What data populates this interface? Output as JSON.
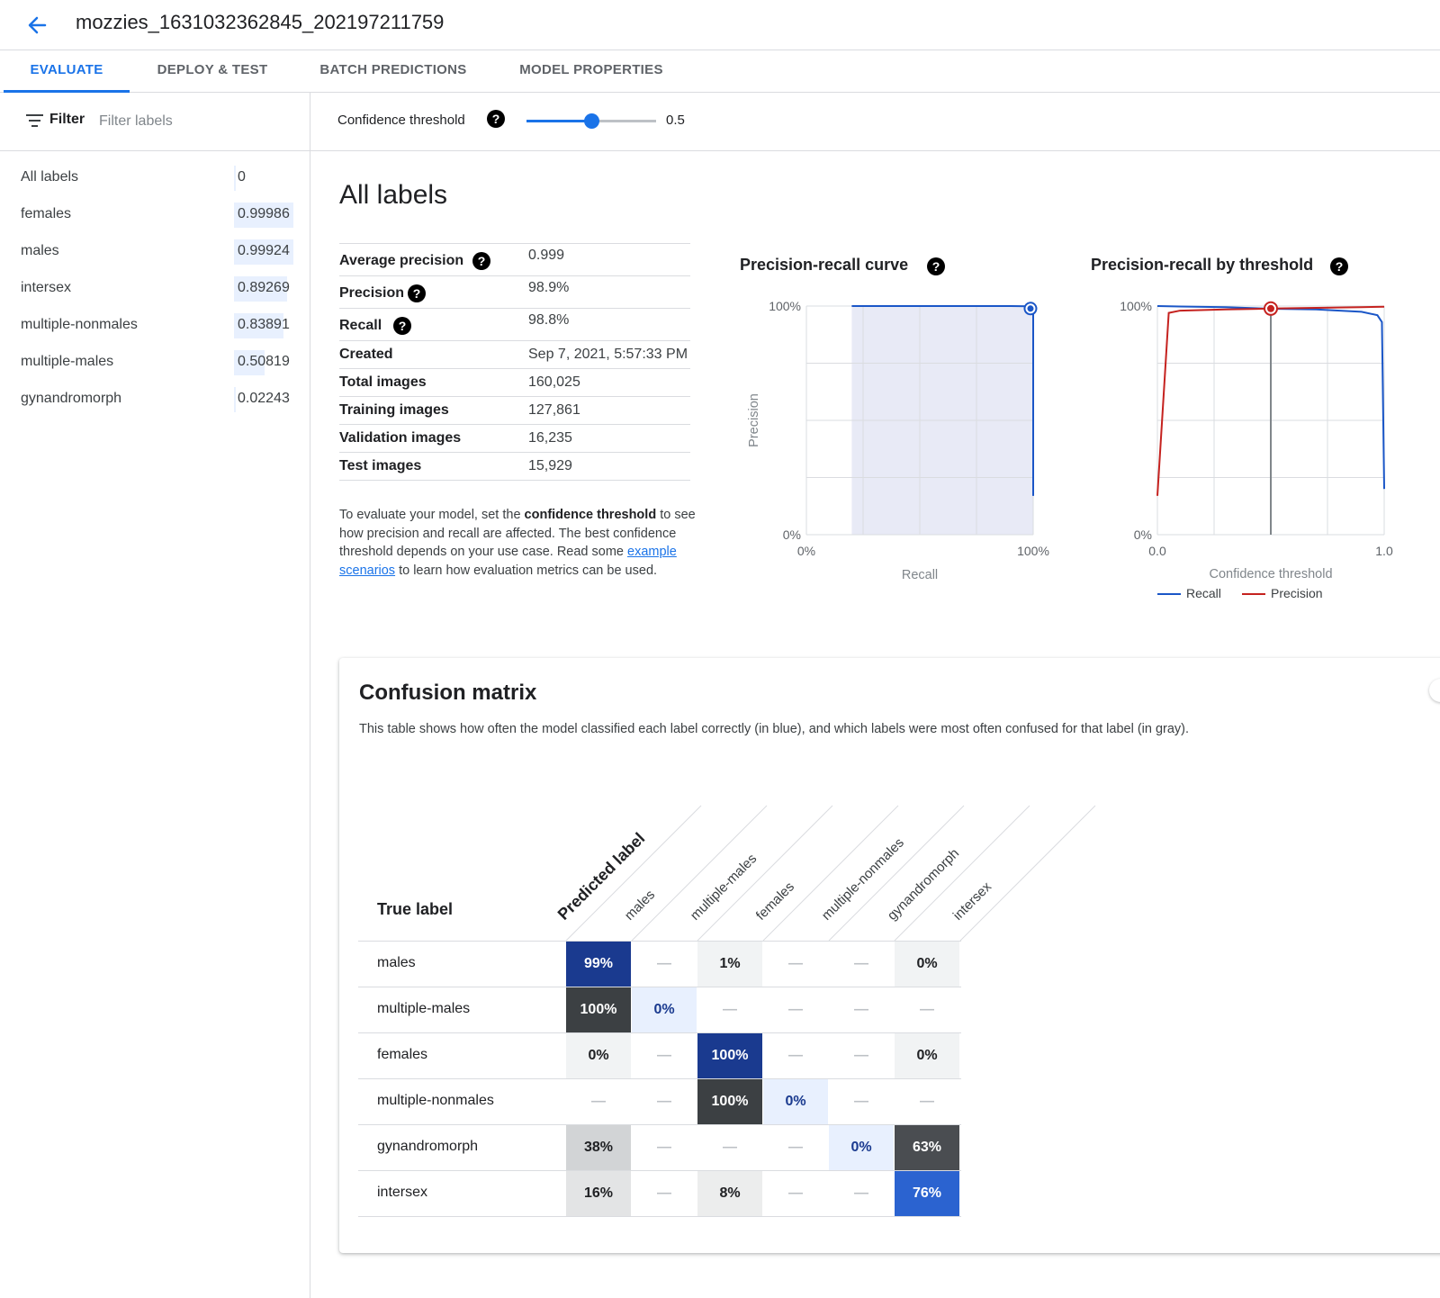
{
  "header": {
    "title": "mozzies_1631032362845_202197211759"
  },
  "tabs": [
    {
      "label": "EVALUATE",
      "active": true
    },
    {
      "label": "DEPLOY & TEST",
      "active": false
    },
    {
      "label": "BATCH PREDICTIONS",
      "active": false
    },
    {
      "label": "MODEL PROPERTIES",
      "active": false
    }
  ],
  "filter": {
    "label": "Filter",
    "placeholder": "Filter labels"
  },
  "labels": [
    {
      "name": "All labels",
      "value": "0"
    },
    {
      "name": "females",
      "value": "0.99986"
    },
    {
      "name": "males",
      "value": "0.99924"
    },
    {
      "name": "intersex",
      "value": "0.89269"
    },
    {
      "name": "multiple-nonmales",
      "value": "0.83891"
    },
    {
      "name": "multiple-males",
      "value": "0.50819"
    },
    {
      "name": "gynandromorph",
      "value": "0.02243"
    }
  ],
  "threshold": {
    "label": "Confidence threshold",
    "value": "0.5",
    "fraction": 0.5
  },
  "main": {
    "title": "All labels"
  },
  "stats": [
    {
      "name": "Average precision",
      "value": "0.999",
      "help": true
    },
    {
      "name": "Precision",
      "value": "98.9%",
      "help": true
    },
    {
      "name": "Recall",
      "value": "98.8%",
      "help": true
    },
    {
      "name": "Created",
      "value": "Sep 7, 2021, 5:57:33 PM",
      "help": false
    },
    {
      "name": "Total images",
      "value": "160,025",
      "help": false
    },
    {
      "name": "Training images",
      "value": "127,861",
      "help": false
    },
    {
      "name": "Validation images",
      "value": "16,235",
      "help": false
    },
    {
      "name": "Test images",
      "value": "15,929",
      "help": false
    }
  ],
  "info": {
    "part1": "To evaluate your model, set the ",
    "bold": "confidence threshold",
    "part2": " to see how precision and recall are affected. The best confidence threshold depends on your use case. Read some ",
    "link": "example scenarios",
    "part3": " to learn how evaluation metrics can be used."
  },
  "chart_data": [
    {
      "type": "area",
      "title": "Precision-recall curve",
      "xlabel": "Recall",
      "ylabel": "Precision",
      "xticks": [
        "0%",
        "100%"
      ],
      "yticks": [
        "100%",
        "0%"
      ],
      "xlim": [
        0,
        1
      ],
      "ylim": [
        0,
        1
      ],
      "shaded_region_x": [
        0.2,
        1.0
      ],
      "series": [
        {
          "x": [
            0.2,
            0.5,
            0.9,
            0.99,
            1.0,
            1.0
          ],
          "y": [
            1.0,
            1.0,
            1.0,
            0.999,
            0.99,
            0.17
          ]
        }
      ],
      "marker": {
        "x": 0.988,
        "y": 0.989
      },
      "grid": true,
      "colors": {
        "line": "#1a56c7",
        "fill": "#e8eaf6",
        "grid": "#dadce0"
      }
    },
    {
      "type": "line",
      "title": "Precision-recall by threshold",
      "xlabel": "Confidence threshold",
      "xticks": [
        "0.0",
        "1.0"
      ],
      "yticks": [
        "100%",
        "0%"
      ],
      "xlim": [
        0,
        1
      ],
      "ylim": [
        0,
        1
      ],
      "legend": "bottom",
      "series": [
        {
          "name": "Recall",
          "x": [
            0.0,
            0.1,
            0.3,
            0.5,
            0.7,
            0.9,
            0.97,
            0.99,
            1.0
          ],
          "y": [
            1.0,
            0.998,
            0.995,
            0.988,
            0.985,
            0.975,
            0.96,
            0.93,
            0.2
          ]
        },
        {
          "name": "Precision",
          "x": [
            0.0,
            0.05,
            0.1,
            0.3,
            0.5,
            0.7,
            0.9,
            1.0
          ],
          "y": [
            0.17,
            0.97,
            0.98,
            0.985,
            0.989,
            0.992,
            0.995,
            0.997
          ]
        }
      ],
      "threshold_marker": {
        "x": 0.5,
        "y": 0.989
      },
      "grid": true,
      "colors": {
        "Recall": "#1a56c7",
        "Precision": "#c5221f",
        "grid": "#dadce0",
        "vline": "#80868b"
      }
    }
  ],
  "confusion": {
    "title": "Confusion matrix",
    "description": "This table shows how often the model classified each label correctly (in blue), and which labels were most often confused for that label (in gray).",
    "true_label_header": "True label",
    "predicted_label_header": "Predicted label",
    "columns": [
      "males",
      "multiple-males",
      "females",
      "multiple-nonmales",
      "gynandromorph",
      "intersex"
    ],
    "rows": [
      {
        "label": "males",
        "cells": [
          {
            "v": "99%",
            "bg": "#1a3a8f",
            "fg": "#ffffff"
          },
          {
            "v": "—",
            "bg": "#ffffff",
            "fg": "#bdc1c6"
          },
          {
            "v": "1%",
            "bg": "#f1f3f4",
            "fg": "#202124"
          },
          {
            "v": "—",
            "bg": "#ffffff",
            "fg": "#bdc1c6"
          },
          {
            "v": "—",
            "bg": "#ffffff",
            "fg": "#bdc1c6"
          },
          {
            "v": "0%",
            "bg": "#f1f3f4",
            "fg": "#202124"
          }
        ]
      },
      {
        "label": "multiple-males",
        "cells": [
          {
            "v": "100%",
            "bg": "#3c4043",
            "fg": "#ffffff"
          },
          {
            "v": "0%",
            "bg": "#e8f0fe",
            "fg": "#1a3a8f"
          },
          {
            "v": "—",
            "bg": "#ffffff",
            "fg": "#bdc1c6"
          },
          {
            "v": "—",
            "bg": "#ffffff",
            "fg": "#bdc1c6"
          },
          {
            "v": "—",
            "bg": "#ffffff",
            "fg": "#bdc1c6"
          },
          {
            "v": "—",
            "bg": "#ffffff",
            "fg": "#bdc1c6"
          }
        ]
      },
      {
        "label": "females",
        "cells": [
          {
            "v": "0%",
            "bg": "#f1f3f4",
            "fg": "#202124"
          },
          {
            "v": "—",
            "bg": "#ffffff",
            "fg": "#bdc1c6"
          },
          {
            "v": "100%",
            "bg": "#1a3a8f",
            "fg": "#ffffff"
          },
          {
            "v": "—",
            "bg": "#ffffff",
            "fg": "#bdc1c6"
          },
          {
            "v": "—",
            "bg": "#ffffff",
            "fg": "#bdc1c6"
          },
          {
            "v": "0%",
            "bg": "#f1f3f4",
            "fg": "#202124"
          }
        ]
      },
      {
        "label": "multiple-nonmales",
        "cells": [
          {
            "v": "—",
            "bg": "#ffffff",
            "fg": "#bdc1c6"
          },
          {
            "v": "—",
            "bg": "#ffffff",
            "fg": "#bdc1c6"
          },
          {
            "v": "100%",
            "bg": "#3c4043",
            "fg": "#ffffff"
          },
          {
            "v": "0%",
            "bg": "#e8f0fe",
            "fg": "#1a3a8f"
          },
          {
            "v": "—",
            "bg": "#ffffff",
            "fg": "#bdc1c6"
          },
          {
            "v": "—",
            "bg": "#ffffff",
            "fg": "#bdc1c6"
          }
        ]
      },
      {
        "label": "gynandromorph",
        "cells": [
          {
            "v": "38%",
            "bg": "#d2d4d6",
            "fg": "#202124"
          },
          {
            "v": "—",
            "bg": "#ffffff",
            "fg": "#bdc1c6"
          },
          {
            "v": "—",
            "bg": "#ffffff",
            "fg": "#bdc1c6"
          },
          {
            "v": "—",
            "bg": "#ffffff",
            "fg": "#bdc1c6"
          },
          {
            "v": "0%",
            "bg": "#e8f0fe",
            "fg": "#1a3a8f"
          },
          {
            "v": "63%",
            "bg": "#4a4d51",
            "fg": "#ffffff"
          }
        ]
      },
      {
        "label": "intersex",
        "cells": [
          {
            "v": "16%",
            "bg": "#e3e4e5",
            "fg": "#202124"
          },
          {
            "v": "—",
            "bg": "#ffffff",
            "fg": "#bdc1c6"
          },
          {
            "v": "8%",
            "bg": "#eceded",
            "fg": "#202124"
          },
          {
            "v": "—",
            "bg": "#ffffff",
            "fg": "#bdc1c6"
          },
          {
            "v": "—",
            "bg": "#ffffff",
            "fg": "#bdc1c6"
          },
          {
            "v": "76%",
            "bg": "#2b63d0",
            "fg": "#ffffff"
          }
        ]
      }
    ]
  },
  "icons": {
    "back": "arrow-back-icon",
    "filter": "filter-list-icon",
    "help": "help-icon"
  },
  "colors": {
    "accent": "#1a73e8"
  }
}
